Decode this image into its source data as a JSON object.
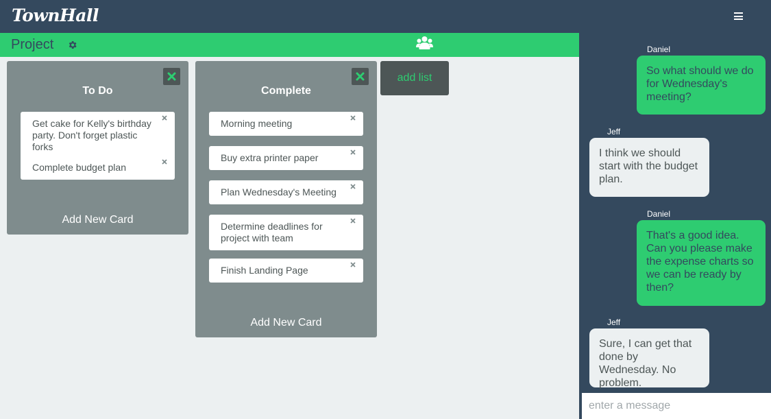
{
  "app": {
    "logo": "TownHall"
  },
  "navbar": {
    "menu_icon": "hamburger-icon"
  },
  "project": {
    "title": "Project",
    "settings_icon": "gear-icon",
    "members_icon": "users-icon"
  },
  "colors": {
    "navy": "#34495e",
    "green": "#2ecc71",
    "gray": "#7f8c8d",
    "dark_gray": "#4d5656",
    "light": "#ecf0f1"
  },
  "board": {
    "lists": [
      {
        "title": "To Do",
        "cards": [
          "Get cake for Kelly's birthday party. Don't forget plastic forks",
          "Complete budget plan"
        ],
        "add_card": "Add New Card"
      },
      {
        "title": "Complete",
        "cards": [
          "Morning meeting",
          "Buy extra printer paper",
          "Plan Wednesday's Meeting",
          "Determine deadlines for project with team",
          "Finish Landing Page"
        ],
        "add_card": "Add New Card"
      }
    ],
    "add_list": "add list"
  },
  "chat": {
    "messages": [
      {
        "sender": "Daniel",
        "text": "So what should we do for Wednesday's meeting?",
        "mine": true
      },
      {
        "sender": "Jeff",
        "text": "I think we should start with the budget plan.",
        "mine": false
      },
      {
        "sender": "Daniel",
        "text": "That's a good idea. Can you please make the expense charts so we can be ready by then?",
        "mine": true
      },
      {
        "sender": "Jeff",
        "text": "Sure, I can get that done by Wednesday. No problem.",
        "mine": false
      }
    ],
    "input_placeholder": "enter a message"
  }
}
